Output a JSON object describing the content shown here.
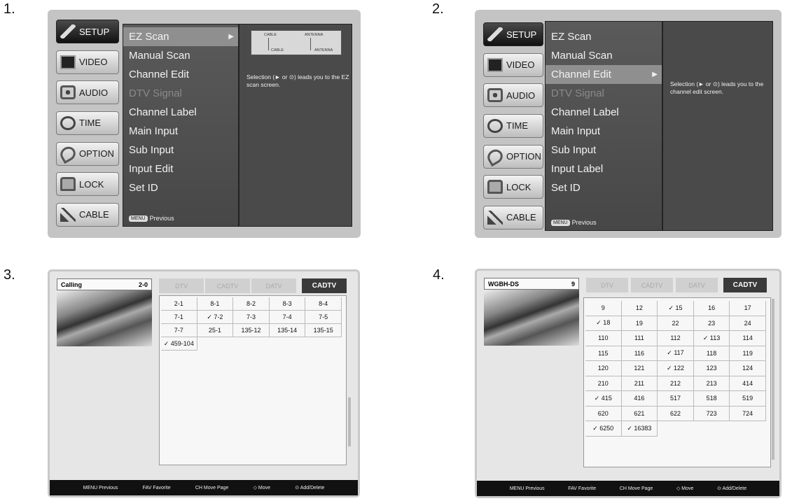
{
  "panels": [
    {
      "number": "1.",
      "tabs": [
        "SETUP",
        "VIDEO",
        "AUDIO",
        "TIME",
        "OPTION",
        "LOCK",
        "CABLE"
      ],
      "menu": [
        "EZ Scan",
        "Manual Scan",
        "Channel Edit",
        "DTV Signal",
        "Channel Label",
        "Main Input",
        "Sub Input",
        "Input Edit",
        "Set ID"
      ],
      "highlighted": 0,
      "disabled": [
        3
      ],
      "prev_key": "MENU",
      "prev_label": "Previous",
      "help": "Selection (► or ⊙) leads you to the EZ scan screen.",
      "diagram": {
        "label_cable_top": "CABLE",
        "label_antenna_top": "ANTENNA",
        "label_cable": "CABLE",
        "label_antenna": "ANTENNA"
      }
    },
    {
      "number": "2.",
      "tabs": [
        "SETUP",
        "VIDEO",
        "AUDIO",
        "TIME",
        "OPTION",
        "LOCK",
        "CABLE"
      ],
      "menu": [
        "EZ Scan",
        "Manual Scan",
        "Channel Edit",
        "DTV Signal",
        "Channel Label",
        "Main Input",
        "Sub Input",
        "Input Label",
        "Set ID"
      ],
      "highlighted": 2,
      "disabled": [
        3
      ],
      "prev_key": "MENU",
      "prev_label": "Previous",
      "help": "Selection (► or ⊙) leads you to the channel edit screen."
    },
    {
      "number": "3.",
      "info_name": "Calling",
      "info_ch": "2-0",
      "tabs": [
        "DTV",
        "CADTV",
        "DATV",
        "CADTV"
      ],
      "active_tab": 3,
      "channels": [
        "2-1",
        "8-1",
        "8-2",
        "8-3",
        "8-4",
        "7-1",
        "✓ 7-2",
        "7-3",
        "7-4",
        "7-5",
        "7-7",
        "25-1",
        "135-12",
        "135-14",
        "135-15",
        "✓ 459-104"
      ],
      "bottom": [
        "MENU Previous",
        "FAV Favorite",
        "CH Move Page",
        "◇ Move",
        "⊙ Add/Delete"
      ]
    },
    {
      "number": "4.",
      "info_name": "WGBH-DS",
      "info_ch": "9",
      "tabs": [
        "DTV",
        "CADTV",
        "DATV",
        "CADTV"
      ],
      "active_tab": 3,
      "channels": [
        "9",
        "12",
        "✓ 15",
        "16",
        "17",
        "✓ 18",
        "19",
        "22",
        "23",
        "24",
        "110",
        "111",
        "112",
        "✓ 113",
        "114",
        "115",
        "116",
        "✓ 117",
        "118",
        "119",
        "120",
        "121",
        "✓ 122",
        "123",
        "124",
        "210",
        "211",
        "212",
        "213",
        "414",
        "✓ 415",
        "416",
        "517",
        "518",
        "519",
        "620",
        "621",
        "622",
        "723",
        "724",
        "✓ 6250",
        "✓ 16383"
      ],
      "bottom": [
        "MENU Previous",
        "FAV Favorite",
        "CH Move Page",
        "◇ Move",
        "⊙ Add/Delete"
      ]
    }
  ]
}
